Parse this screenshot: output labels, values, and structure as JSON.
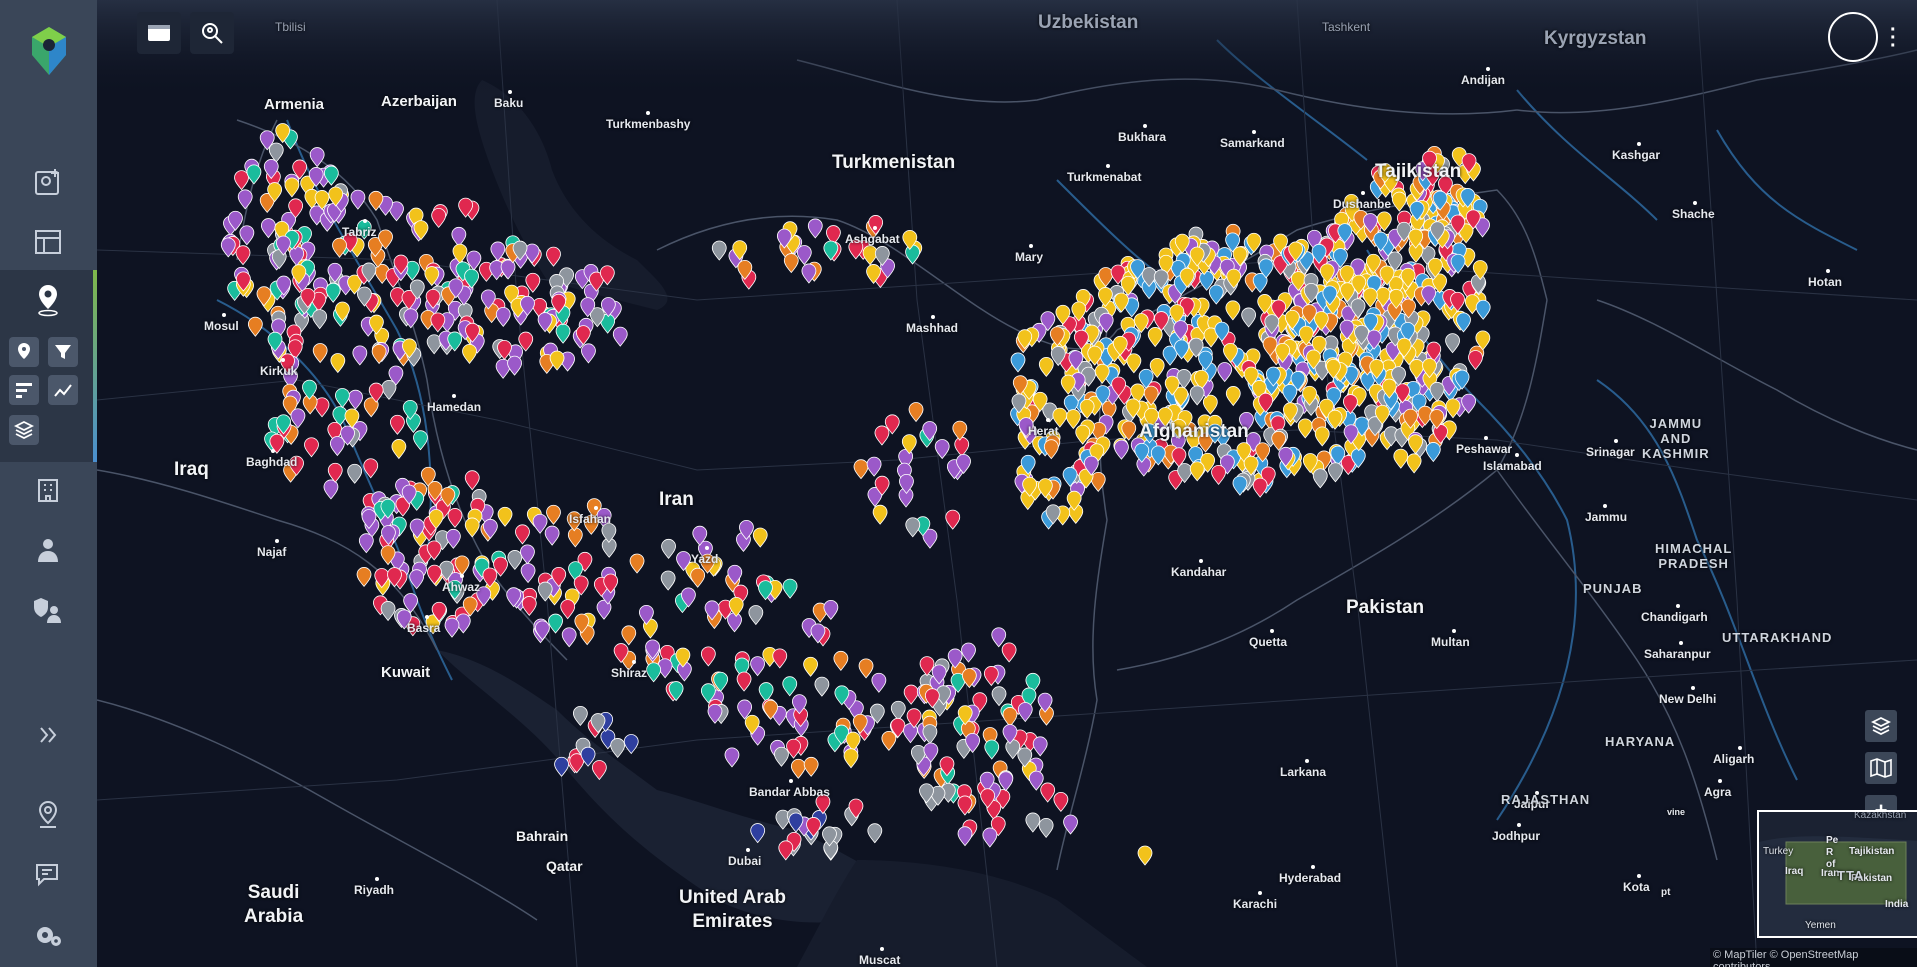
{
  "sidebar": {
    "logo": "hexagon-pin-logo",
    "items": [
      {
        "name": "map-add-icon"
      },
      {
        "name": "dashboard-layout-icon"
      },
      {
        "name": "location-pin-icon",
        "active": true
      },
      {
        "name": "building-icon"
      },
      {
        "name": "user-badge-icon"
      },
      {
        "name": "shield-users-icon"
      },
      {
        "name": "expand-chevrons-icon"
      },
      {
        "name": "location-settings-icon"
      },
      {
        "name": "report-edit-icon"
      },
      {
        "name": "settings-gear-icon"
      }
    ],
    "sub_tools": [
      "pin-tool-icon",
      "filter-icon",
      "bar-chart-icon",
      "trend-chart-icon",
      "layers-stack-icon"
    ]
  },
  "map": {
    "countries": [
      {
        "t": "Uzbekistan",
        "dim": true
      },
      {
        "t": "Kyrgyzstan",
        "dim": true
      },
      {
        "t": "Armenia"
      },
      {
        "t": "Azerbaijan"
      },
      {
        "t": "Turkmenistan"
      },
      {
        "t": "Tajikistan"
      },
      {
        "t": "Iraq"
      },
      {
        "t": "Iran"
      },
      {
        "t": "Afghanistan"
      },
      {
        "t": "Pakistan"
      },
      {
        "t": "Kuwait"
      },
      {
        "t": "Bahrain"
      },
      {
        "t": "Qatar"
      },
      {
        "t": "Saudi\nArabia"
      },
      {
        "t": "United Arab\nEmirates"
      }
    ],
    "cities": [
      "Tbilisi",
      "Tashkent",
      "Baku",
      "Turkmenbashy",
      "Andijan",
      "Bukhara",
      "Samarkand",
      "Kashgar",
      "Turkmenabat",
      "Dushanbe",
      "Shache",
      "Tabriz",
      "Ashgabat",
      "Mary",
      "Mosul",
      "Mashhad",
      "Hotan",
      "Kirkuk",
      "Hamedan",
      "Herat",
      "Peshawar",
      "Srinagar",
      "Islamabad",
      "Baghdad",
      "Isfahan",
      "Jammu",
      "Najaf",
      "Yazd",
      "Kandahar",
      "Ahwaz",
      "Chandigarh",
      "Basra",
      "Quetta",
      "Multan",
      "Shiraz",
      "Saharanpur",
      "New Delhi",
      "Aligarh",
      "Agra",
      "Larkana",
      "Bandar Abbas",
      "Jodhpur",
      "Jaipur",
      "Dubai",
      "Hyderabad",
      "Kota",
      "Riyadh",
      "Karachi",
      "Muscat"
    ],
    "regions": [
      "JAMMU\nAND\nKASHMIR",
      "HIMACHAL\nPRADESH",
      "PUNJAB",
      "UTTARAKHAND",
      "HARYANA",
      "RAJASTHAN"
    ],
    "minimap_labels": [
      "Kazakhstan",
      "Turkey",
      "Tajikistan",
      "Iraq",
      "Iran",
      "Pakistan",
      "India",
      "Yemen",
      "Pe",
      "R",
      "of",
      "pt",
      "vine",
      "TTA"
    ],
    "attribution": "© MapTiler © OpenStreetMap contributors",
    "marker_colors": {
      "yellow": "#f2c21b",
      "blue": "#3b9ad9",
      "purple": "#9b59c9",
      "red": "#e0284f",
      "teal": "#1abc9c",
      "gray": "#8e959e",
      "orange": "#e67e22",
      "navy": "#2f3f9f"
    }
  },
  "controls": {
    "top_buttons": [
      "panel-toggle-icon",
      "search-location-icon"
    ],
    "map_buttons": [
      "layers-icon",
      "basemap-icon",
      "zoom-in-icon",
      "zoom-out-icon",
      "compass-icon",
      "fullscreen-icon"
    ],
    "zoom_in": "+",
    "zoom_out": "−"
  }
}
